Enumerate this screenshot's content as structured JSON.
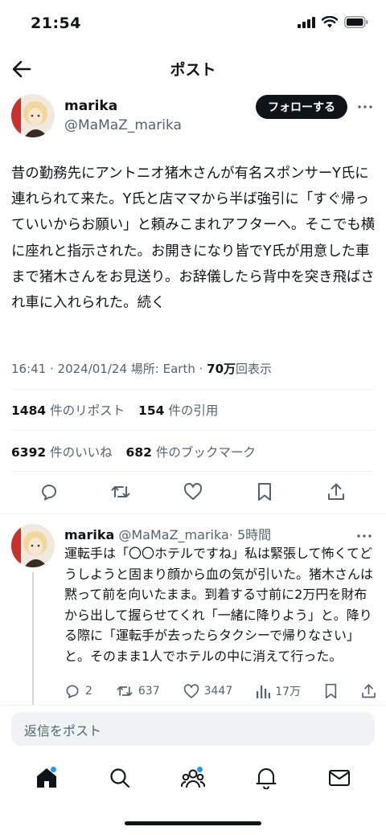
{
  "status_bar": {
    "time": "21:54"
  },
  "header": {
    "title": "ポスト"
  },
  "author": {
    "name": "marika",
    "handle": "@MaMaZ_marika",
    "follow_label": "フォローする"
  },
  "tweet": {
    "text": "昔の勤務先にアントニオ猪木さんが有名スポンサーY氏に連れられて来た。Y氏と店ママから半ば強引に「すぐ帰っていいからお願い」と頼みこまれアフターへ。そこでも横に座れと指示された。お開きになり皆でY氏が用意した車まで猪木さんをお見送り。お辞儀したら背中を突き飛ばされ車に入れられた。続く",
    "timestamp": "16:41 · 2024/01/24",
    "location": "場所: Earth",
    "views_count": "70万",
    "views_label": "回表示"
  },
  "stats": {
    "reposts_count": "1484",
    "reposts_label": "件のリポスト",
    "quotes_count": "154",
    "quotes_label": "件の引用",
    "likes_count": "6392",
    "likes_label": "件のいいね",
    "bookmarks_count": "682",
    "bookmarks_label": "件のブックマーク"
  },
  "reply": {
    "name": "marika",
    "handle": "@MaMaZ_marika",
    "time": "· 5時間",
    "text": "運転手は「〇〇ホテルですね」私は緊張して怖くてどうしようと固まり顔から血の気が引いた。猪木さんは黙って前を向いたまま。到着する寸前に2万円を財布から出して握らせてくれ「一緒に降りよう」と。降りる際に「運転手が去ったらタクシーで帰りなさい」と。そのまま1人でホテルの中に消えて行った。",
    "replies": "2",
    "reposts": "637",
    "likes": "3447",
    "views": "17万"
  },
  "compose": {
    "placeholder": "返信をポスト"
  },
  "tabs": [
    {
      "icon": "home-icon",
      "has_dot": true
    },
    {
      "icon": "search-icon",
      "has_dot": false
    },
    {
      "icon": "communities-icon",
      "has_dot": true
    },
    {
      "icon": "bell-icon",
      "has_dot": false
    },
    {
      "icon": "mail-icon",
      "has_dot": false
    }
  ],
  "colors": {
    "accent": "#1d9bf0",
    "text": "#0f1419",
    "secondary": "#536471",
    "follow_bg": "#0f1419"
  }
}
